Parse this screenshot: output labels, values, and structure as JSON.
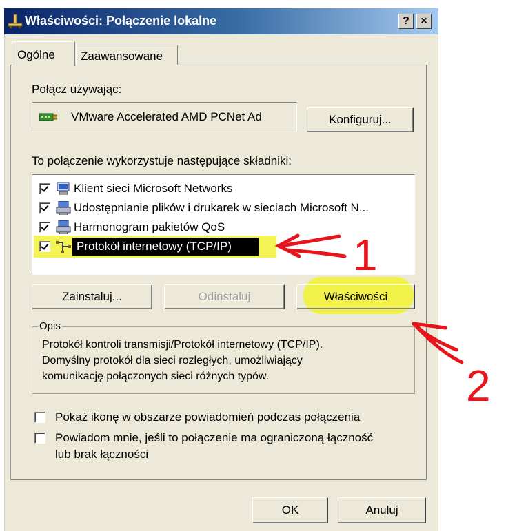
{
  "window": {
    "title": "Właściwości: Połączenie lokalne",
    "help_button": "?",
    "close_button": "×"
  },
  "tabs": [
    {
      "label": "Ogólne",
      "active": true
    },
    {
      "label": "Zaawansowane",
      "active": false
    }
  ],
  "connect_using": {
    "label": "Połącz używając:",
    "adapter_name": "VMware Accelerated AMD PCNet Ad",
    "configure_button": "Konfiguruj..."
  },
  "components": {
    "label": "To połączenie wykorzystuje następujące składniki:",
    "items": [
      {
        "label": "Klient sieci Microsoft Networks",
        "checked": true,
        "icon": "network-client-icon",
        "selected": false
      },
      {
        "label": "Udostępnianie plików i drukarek w sieciach Microsoft N...",
        "checked": true,
        "icon": "file-printer-sharing-icon",
        "selected": false
      },
      {
        "label": "Harmonogram pakietów QoS",
        "checked": true,
        "icon": "qos-scheduler-icon",
        "selected": false
      },
      {
        "label": "Protokół internetowy (TCP/IP)",
        "checked": true,
        "icon": "network-protocol-icon",
        "selected": true
      }
    ]
  },
  "buttons": {
    "install": "Zainstaluj...",
    "uninstall": "Odinstaluj",
    "properties": "Właściwości"
  },
  "description": {
    "legend": "Opis",
    "line1": "Protokół kontroli transmisji/Protokół internetowy (TCP/IP).",
    "line2": "Domyślny protokół dla sieci rozległych, umożliwiający",
    "line3": "komunikację połączonych sieci różnych typów."
  },
  "options": {
    "show_icon": {
      "label": "Pokaż ikonę w obszarze powiadomień podczas połączenia",
      "checked": false
    },
    "notify": {
      "line1": "Powiadom mnie, jeśli to połączenie ma ograniczoną łączność",
      "line2": "lub brak łączności",
      "checked": false
    }
  },
  "footer": {
    "ok": "OK",
    "cancel": "Anuluj"
  },
  "annotations": {
    "label_1": "1",
    "label_2": "2",
    "color": "#e8141c",
    "highlight_color": "#f2f23a"
  }
}
